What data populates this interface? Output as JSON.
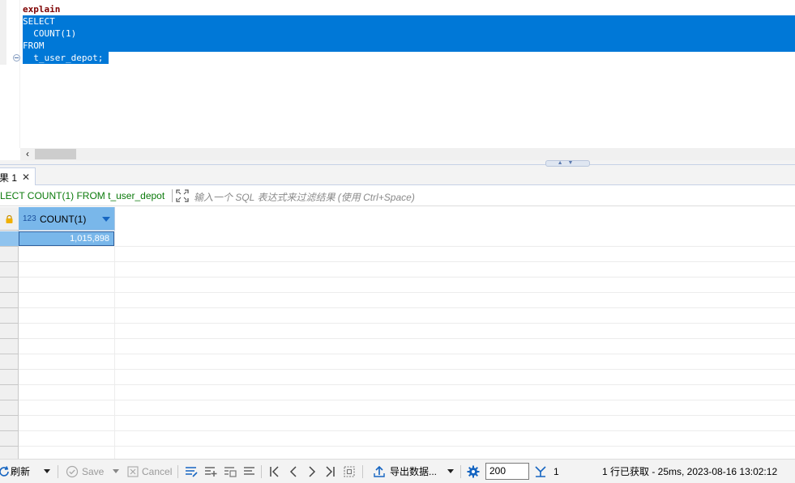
{
  "editor": {
    "lines": [
      "explain",
      "SELECT",
      "  COUNT(1)",
      "FROM",
      "  t_user_depot;"
    ]
  },
  "results": {
    "tab_label": "果 1",
    "tab_close": "✕",
    "query_text": "LECT COUNT(1) FROM t_user_depot",
    "filter_placeholder": "输入一个 SQL 表达式来过滤结果 (使用 Ctrl+Space)",
    "column": {
      "type_badge": "123",
      "name": "COUNT(1)"
    },
    "rows": [
      [
        "1,015,898"
      ]
    ]
  },
  "toolbar": {
    "refresh_label": "刷新",
    "save_label": "Save",
    "cancel_label": "Cancel",
    "export_label": "导出数据...",
    "fetch_size": "200",
    "fetch_count": "1",
    "status": "1 行已获取 - 25ms, 2023-08-16 13:02:12"
  },
  "colors": {
    "selection": "#0078d7",
    "keyword": "#7f0000",
    "query_green": "#0b7a0b",
    "header_blue": "#79b7ea",
    "icon_blue": "#1665c1"
  }
}
